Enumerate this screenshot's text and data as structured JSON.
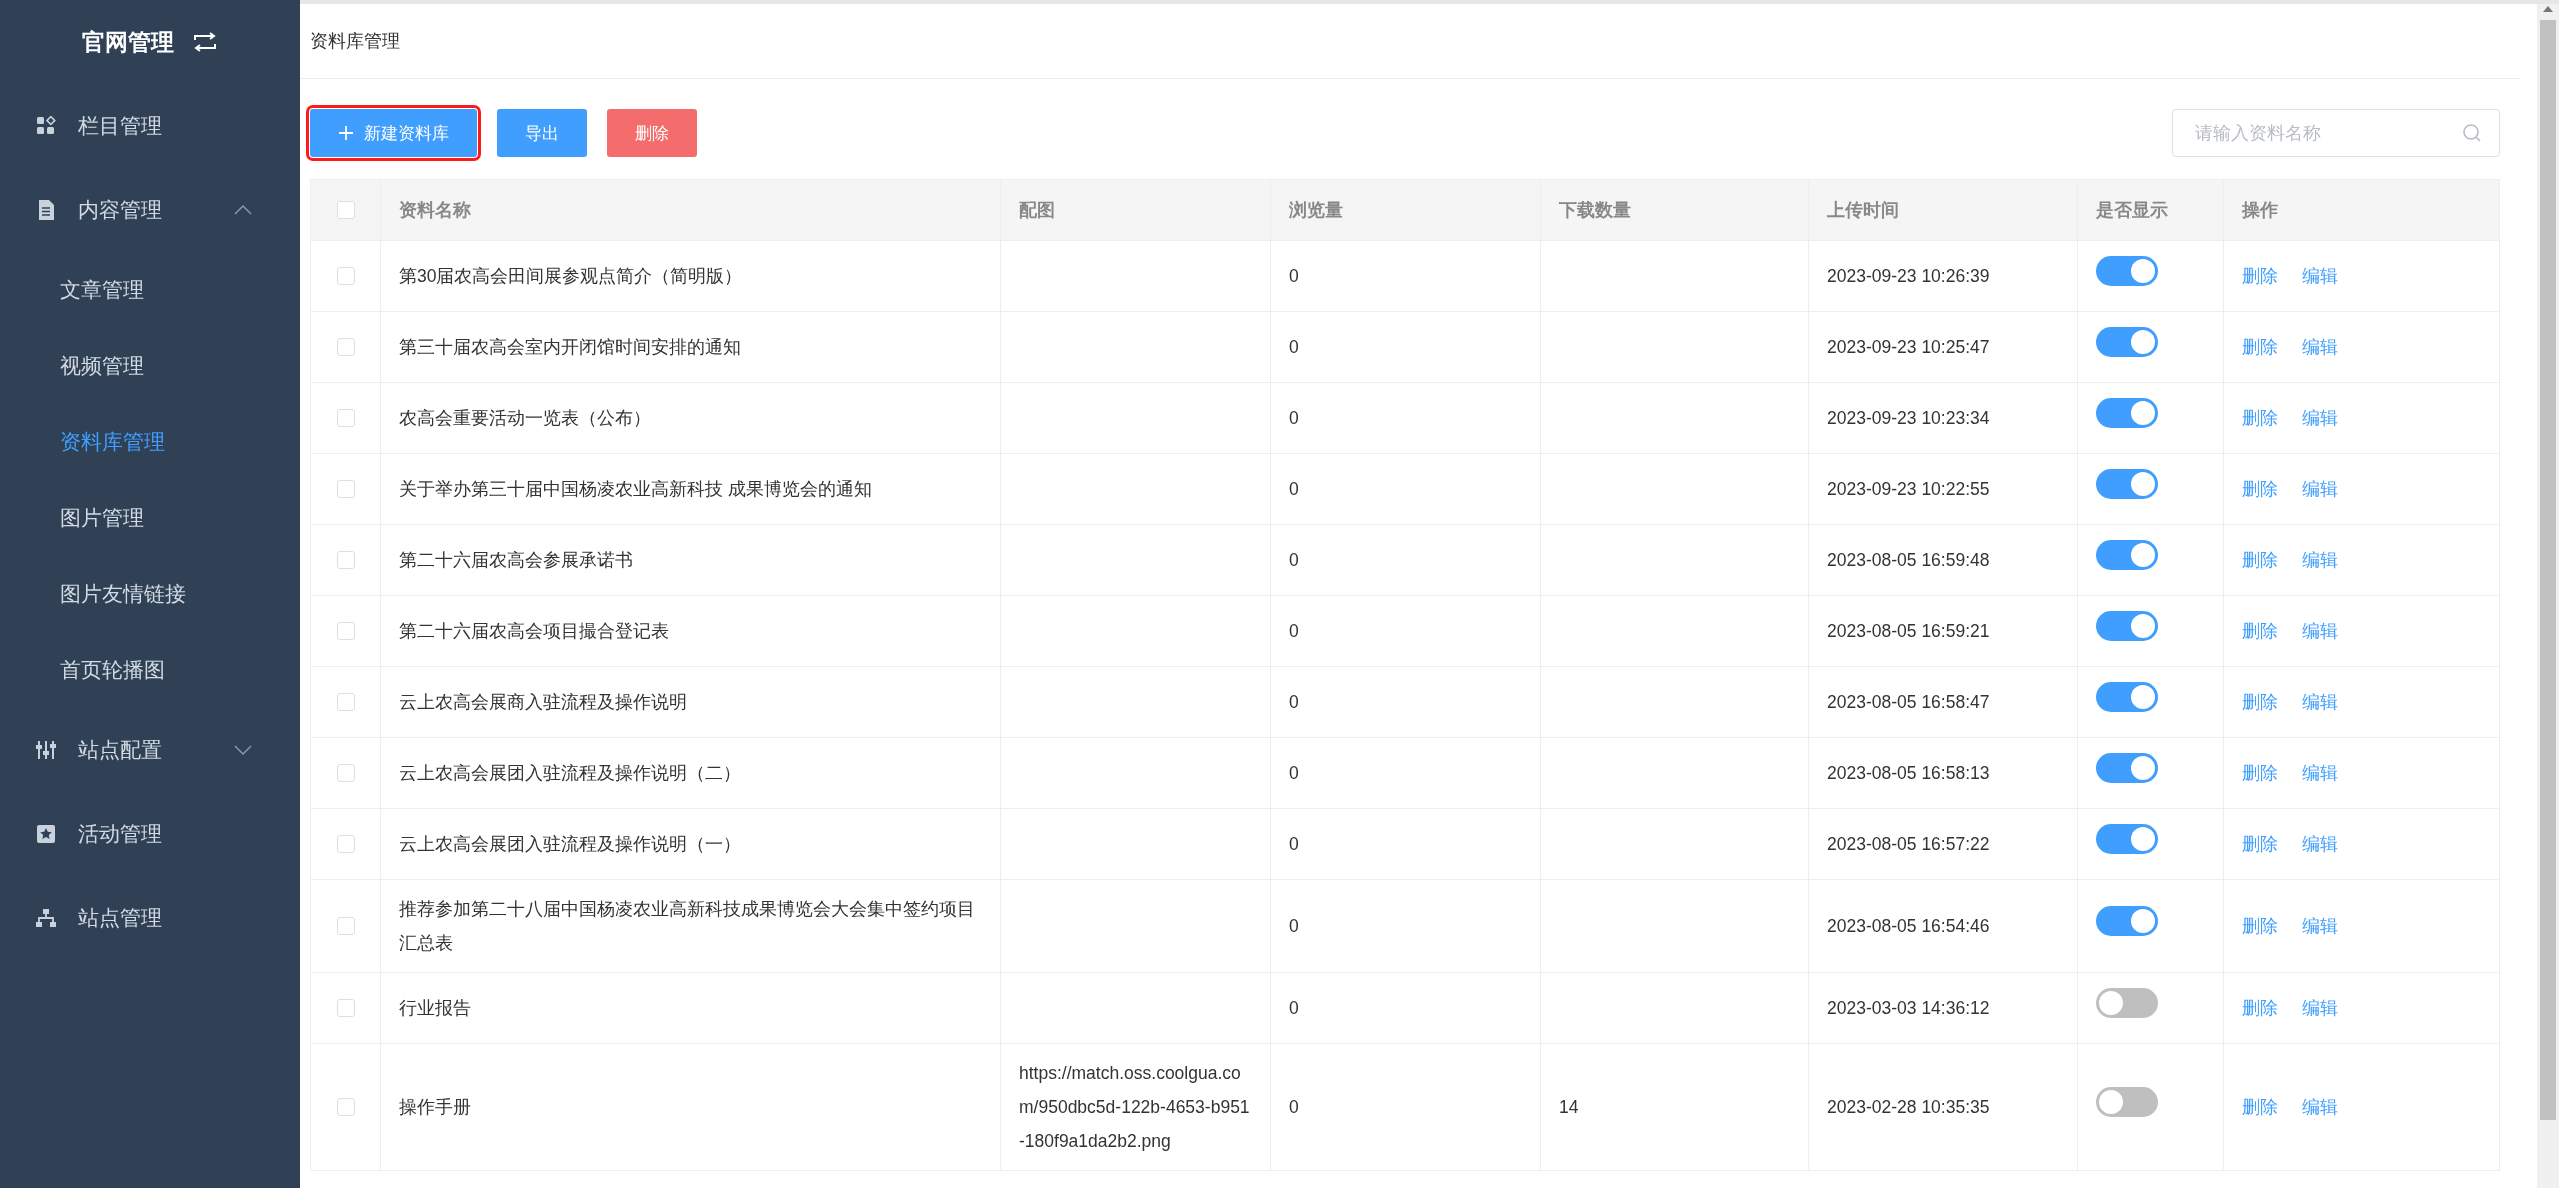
{
  "sidebar": {
    "title": "官网管理",
    "items": [
      {
        "label": "栏目管理",
        "kind": "item"
      },
      {
        "label": "内容管理",
        "kind": "group",
        "expanded": true,
        "children": [
          {
            "label": "文章管理",
            "selected": false
          },
          {
            "label": "视频管理",
            "selected": false
          },
          {
            "label": "资料库管理",
            "selected": true
          },
          {
            "label": "图片管理",
            "selected": false
          },
          {
            "label": "图片友情链接",
            "selected": false
          },
          {
            "label": "首页轮播图",
            "selected": false
          }
        ]
      },
      {
        "label": "站点配置",
        "kind": "group",
        "expanded": false
      },
      {
        "label": "活动管理",
        "kind": "item"
      },
      {
        "label": "站点管理",
        "kind": "item"
      }
    ]
  },
  "breadcrumb": "资料库管理",
  "toolbar": {
    "buttons": [
      {
        "label": "新建资料库",
        "kind": "primary",
        "highlighted": true
      },
      {
        "label": "导出",
        "kind": "plain",
        "highlighted": false
      },
      {
        "label": "删除",
        "kind": "danger",
        "highlighted": false
      }
    ],
    "search": {
      "placeholder": "请输入资料名称"
    }
  },
  "table": {
    "select_all": {
      "checked": false
    },
    "columns": [
      "资料名称",
      "配图",
      "浏览量",
      "下载数量",
      "上传时间",
      "是否显示",
      "操作"
    ],
    "rows": [
      {
        "checked": false,
        "name": "第30届农高会田间展参观点简介（简明版）",
        "views": "0",
        "time": "2023-09-23 10:26:39",
        "shown": true,
        "actions": [
          "删除",
          "编辑"
        ]
      },
      {
        "checked": false,
        "name": "第三十届农高会室内开闭馆时间安排的通知",
        "views": "0",
        "time": "2023-09-23 10:25:47",
        "shown": true,
        "actions": [
          "删除",
          "编辑"
        ]
      },
      {
        "checked": false,
        "name": "农高会重要活动一览表（公布）",
        "views": "0",
        "time": "2023-09-23 10:23:34",
        "shown": true,
        "actions": [
          "删除",
          "编辑"
        ]
      },
      {
        "checked": false,
        "name": "关于举办第三十届中国杨凌农业高新科技 成果博览会的通知",
        "views": "0",
        "time": "2023-09-23 10:22:55",
        "shown": true,
        "actions": [
          "删除",
          "编辑"
        ]
      },
      {
        "checked": false,
        "name": "第二十六届农高会参展承诺书",
        "views": "0",
        "time": "2023-08-05 16:59:48",
        "shown": true,
        "actions": [
          "删除",
          "编辑"
        ]
      },
      {
        "checked": false,
        "name": "第二十六届农高会项目撮合登记表",
        "views": "0",
        "time": "2023-08-05 16:59:21",
        "shown": true,
        "actions": [
          "删除",
          "编辑"
        ]
      },
      {
        "checked": false,
        "name": "云上农高会展商入驻流程及操作说明",
        "views": "0",
        "time": "2023-08-05 16:58:47",
        "shown": true,
        "actions": [
          "删除",
          "编辑"
        ]
      },
      {
        "checked": false,
        "name": "云上农高会展团入驻流程及操作说明（二）",
        "views": "0",
        "time": "2023-08-05 16:58:13",
        "shown": true,
        "actions": [
          "删除",
          "编辑"
        ]
      },
      {
        "checked": false,
        "name": "云上农高会展团入驻流程及操作说明（一）",
        "views": "0",
        "time": "2023-08-05 16:57:22",
        "shown": true,
        "actions": [
          "删除",
          "编辑"
        ]
      },
      {
        "checked": false,
        "name": "推荐参加第二十八届中国杨凌农业高新科技成果博览会大会集中签约项目汇总表",
        "views": "0",
        "time": "2023-08-05 16:54:46",
        "shown": true,
        "actions": [
          "删除",
          "编辑"
        ]
      },
      {
        "checked": false,
        "name": "行业报告",
        "views": "0",
        "time": "2023-03-03 14:36:12",
        "shown": false,
        "actions": [
          "删除",
          "编辑"
        ]
      },
      {
        "checked": false,
        "name": "操作手册",
        "image": "https://match.oss.coolgua.com/950dbc5d-122b-4653-b951-180f9a1da2b2.png",
        "views": "0",
        "downloads": "14",
        "time": "2023-02-28 10:35:35",
        "shown": false,
        "actions": [
          "删除",
          "编辑"
        ]
      }
    ]
  }
}
